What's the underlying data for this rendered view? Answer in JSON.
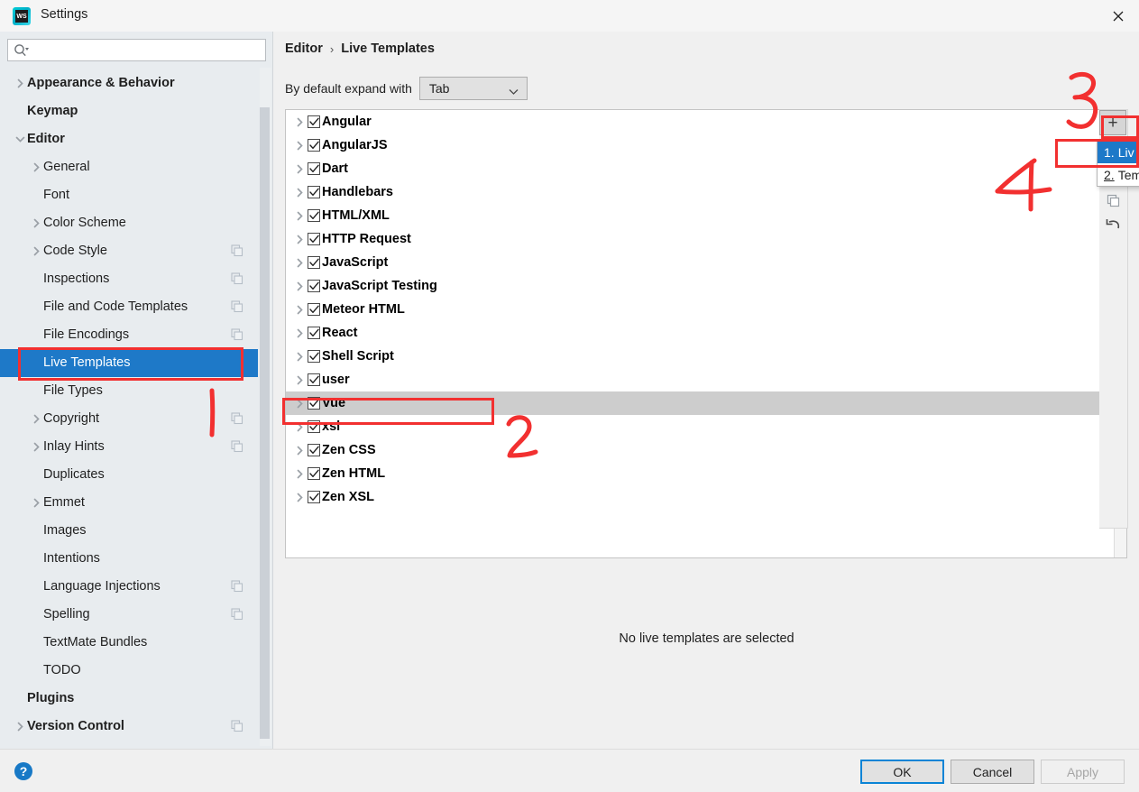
{
  "window": {
    "title": "Settings",
    "logo_text": "WS",
    "close_label": "✕"
  },
  "sidebar": {
    "search": {
      "value": "",
      "placeholder": ""
    },
    "items": [
      {
        "label": "Appearance & Behavior",
        "level": 0,
        "bold": true,
        "arrow": "right",
        "selected": false,
        "copy_badge": false
      },
      {
        "label": "Keymap",
        "level": 0,
        "bold": true,
        "arrow": "none",
        "selected": false,
        "copy_badge": false
      },
      {
        "label": "Editor",
        "level": 0,
        "bold": true,
        "arrow": "down",
        "selected": false,
        "copy_badge": false
      },
      {
        "label": "General",
        "level": 1,
        "bold": false,
        "arrow": "right",
        "selected": false,
        "copy_badge": false
      },
      {
        "label": "Font",
        "level": 1,
        "bold": false,
        "arrow": "none",
        "selected": false,
        "copy_badge": false
      },
      {
        "label": "Color Scheme",
        "level": 1,
        "bold": false,
        "arrow": "right",
        "selected": false,
        "copy_badge": false
      },
      {
        "label": "Code Style",
        "level": 1,
        "bold": false,
        "arrow": "right",
        "selected": false,
        "copy_badge": true
      },
      {
        "label": "Inspections",
        "level": 1,
        "bold": false,
        "arrow": "none",
        "selected": false,
        "copy_badge": true
      },
      {
        "label": "File and Code Templates",
        "level": 1,
        "bold": false,
        "arrow": "none",
        "selected": false,
        "copy_badge": true
      },
      {
        "label": "File Encodings",
        "level": 1,
        "bold": false,
        "arrow": "none",
        "selected": false,
        "copy_badge": true
      },
      {
        "label": "Live Templates",
        "level": 1,
        "bold": false,
        "arrow": "none",
        "selected": true,
        "copy_badge": false
      },
      {
        "label": "File Types",
        "level": 1,
        "bold": false,
        "arrow": "none",
        "selected": false,
        "copy_badge": false
      },
      {
        "label": "Copyright",
        "level": 1,
        "bold": false,
        "arrow": "right",
        "selected": false,
        "copy_badge": true
      },
      {
        "label": "Inlay Hints",
        "level": 1,
        "bold": false,
        "arrow": "right",
        "selected": false,
        "copy_badge": true
      },
      {
        "label": "Duplicates",
        "level": 1,
        "bold": false,
        "arrow": "none",
        "selected": false,
        "copy_badge": false
      },
      {
        "label": "Emmet",
        "level": 1,
        "bold": false,
        "arrow": "right",
        "selected": false,
        "copy_badge": false
      },
      {
        "label": "Images",
        "level": 1,
        "bold": false,
        "arrow": "none",
        "selected": false,
        "copy_badge": false
      },
      {
        "label": "Intentions",
        "level": 1,
        "bold": false,
        "arrow": "none",
        "selected": false,
        "copy_badge": false
      },
      {
        "label": "Language Injections",
        "level": 1,
        "bold": false,
        "arrow": "none",
        "selected": false,
        "copy_badge": true
      },
      {
        "label": "Spelling",
        "level": 1,
        "bold": false,
        "arrow": "none",
        "selected": false,
        "copy_badge": true
      },
      {
        "label": "TextMate Bundles",
        "level": 1,
        "bold": false,
        "arrow": "none",
        "selected": false,
        "copy_badge": false
      },
      {
        "label": "TODO",
        "level": 1,
        "bold": false,
        "arrow": "none",
        "selected": false,
        "copy_badge": false
      },
      {
        "label": "Plugins",
        "level": 0,
        "bold": true,
        "arrow": "none",
        "selected": false,
        "copy_badge": false
      },
      {
        "label": "Version Control",
        "level": 0,
        "bold": true,
        "arrow": "right",
        "selected": false,
        "copy_badge": true
      }
    ]
  },
  "main": {
    "breadcrumb": {
      "root": "Editor",
      "separator": "›",
      "current": "Live Templates"
    },
    "expand_with": {
      "label": "By default expand with",
      "value": "Tab"
    },
    "templates": [
      {
        "name": "Angular",
        "checked": true,
        "selected": false
      },
      {
        "name": "AngularJS",
        "checked": true,
        "selected": false
      },
      {
        "name": "Dart",
        "checked": true,
        "selected": false
      },
      {
        "name": "Handlebars",
        "checked": true,
        "selected": false
      },
      {
        "name": "HTML/XML",
        "checked": true,
        "selected": false
      },
      {
        "name": "HTTP Request",
        "checked": true,
        "selected": false
      },
      {
        "name": "JavaScript",
        "checked": true,
        "selected": false
      },
      {
        "name": "JavaScript Testing",
        "checked": true,
        "selected": false
      },
      {
        "name": "Meteor HTML",
        "checked": true,
        "selected": false
      },
      {
        "name": "React",
        "checked": true,
        "selected": false
      },
      {
        "name": "Shell Script",
        "checked": true,
        "selected": false
      },
      {
        "name": "user",
        "checked": true,
        "selected": false
      },
      {
        "name": "Vue",
        "checked": true,
        "selected": true
      },
      {
        "name": "xsl",
        "checked": true,
        "selected": false
      },
      {
        "name": "Zen CSS",
        "checked": true,
        "selected": false
      },
      {
        "name": "Zen HTML",
        "checked": true,
        "selected": false
      },
      {
        "name": "Zen XSL",
        "checked": true,
        "selected": false
      }
    ],
    "empty_message": "No live templates are selected"
  },
  "toolbar": {
    "add_label": "+"
  },
  "add_menu": {
    "items": [
      {
        "number": "1.",
        "label": "Liv",
        "highlighted": true
      },
      {
        "number": "2.",
        "label": "Tem",
        "highlighted": false
      }
    ]
  },
  "footer": {
    "ok": "OK",
    "cancel": "Cancel",
    "apply": "Apply",
    "apply_disabled": true
  },
  "annotations": {
    "color": "#f23030",
    "marks": [
      {
        "id": "live-templates-box",
        "shape": "rect",
        "note": "red rectangle around Live Templates sidebar item"
      },
      {
        "id": "vue-row-box",
        "shape": "rect",
        "note": "red rectangle around Vue list row"
      },
      {
        "id": "plus-button-box",
        "shape": "rect",
        "note": "red rectangle around + toolbar button"
      },
      {
        "id": "menu-item-box",
        "shape": "rect",
        "note": "red rectangle around first popup menu item"
      },
      {
        "id": "digit-1",
        "shape": "digit",
        "value": "1"
      },
      {
        "id": "digit-2",
        "shape": "digit",
        "value": "2"
      },
      {
        "id": "digit-3",
        "shape": "digit",
        "value": "3"
      },
      {
        "id": "digit-4",
        "shape": "digit",
        "value": "4"
      }
    ]
  }
}
